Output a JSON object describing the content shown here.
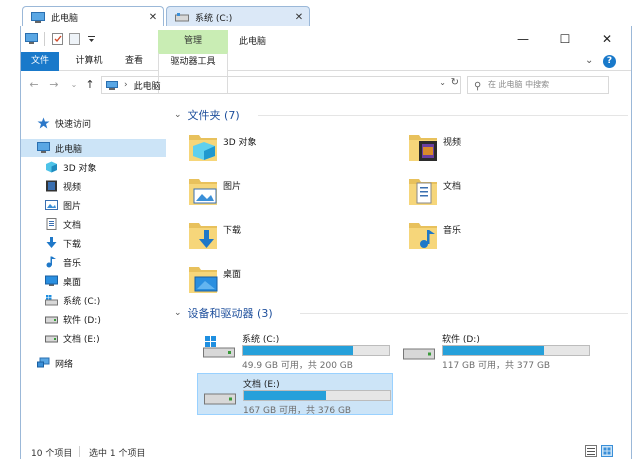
{
  "tabs": [
    {
      "label": "此电脑",
      "close": "✕",
      "icon": "computer-icon"
    },
    {
      "label": "系统 (C:)",
      "close": "✕",
      "icon": "drive-icon"
    }
  ],
  "titlebar": {
    "context_header": "管理",
    "title": "此电脑",
    "minimize": "—",
    "maximize": "☐",
    "close": "✕"
  },
  "ribbon": {
    "tabs": [
      "文件",
      "计算机",
      "查看",
      "驱动器工具"
    ],
    "expand": "⌄",
    "help": "?"
  },
  "address": {
    "back": "←",
    "forward": "→",
    "recent": "⌄",
    "up": "↑",
    "separator": "›",
    "crumb": "此电脑",
    "refresh": "↻",
    "dropdown": "⌄",
    "search_placeholder": "在 此电脑 中搜索"
  },
  "sidebar": {
    "items": [
      {
        "label": "快速访问",
        "icon": "star-icon"
      },
      {
        "label": "此电脑",
        "icon": "computer-icon",
        "selected": true
      },
      {
        "label": "3D 对象",
        "icon": "cube-icon"
      },
      {
        "label": "视频",
        "icon": "film-icon"
      },
      {
        "label": "图片",
        "icon": "picture-icon"
      },
      {
        "label": "文档",
        "icon": "document-icon"
      },
      {
        "label": "下载",
        "icon": "download-icon"
      },
      {
        "label": "音乐",
        "icon": "music-icon"
      },
      {
        "label": "桌面",
        "icon": "desktop-icon"
      },
      {
        "label": "系统 (C:)",
        "icon": "windows-drive-icon"
      },
      {
        "label": "软件 (D:)",
        "icon": "drive-icon"
      },
      {
        "label": "文档 (E:)",
        "icon": "drive-icon"
      },
      {
        "label": "网络",
        "icon": "network-icon"
      }
    ]
  },
  "main": {
    "folders_header": "文件夹 (7)",
    "folders": [
      {
        "label": "3D 对象",
        "icon": "cube-folder-icon"
      },
      {
        "label": "视频",
        "icon": "video-folder-icon"
      },
      {
        "label": "图片",
        "icon": "pictures-folder-icon"
      },
      {
        "label": "文档",
        "icon": "documents-folder-icon"
      },
      {
        "label": "下载",
        "icon": "downloads-folder-icon"
      },
      {
        "label": "音乐",
        "icon": "music-folder-icon"
      },
      {
        "label": "桌面",
        "icon": "desktop-folder-icon"
      }
    ],
    "drives_header": "设备和驱动器 (3)",
    "drives": [
      {
        "name": "系统 (C:)",
        "free_text": "49.9 GB 可用，共 200 GB",
        "used_fraction": 0.75,
        "icon": "windows-drive-icon"
      },
      {
        "name": "软件 (D:)",
        "free_text": "117 GB 可用，共 377 GB",
        "used_fraction": 0.69,
        "icon": "drive-icon"
      },
      {
        "name": "文档 (E:)",
        "free_text": "167 GB 可用，共 376 GB",
        "used_fraction": 0.56,
        "icon": "drive-icon",
        "selected": true
      }
    ]
  },
  "status": {
    "count": "10 个项目",
    "selected": "选中 1 个项目"
  },
  "colors": {
    "accent": "#1979ca",
    "selection": "#cce4f7",
    "bar_fill": "#26a0da",
    "group_header": "#1e4f9c",
    "context_tab": "#c9edb4"
  }
}
